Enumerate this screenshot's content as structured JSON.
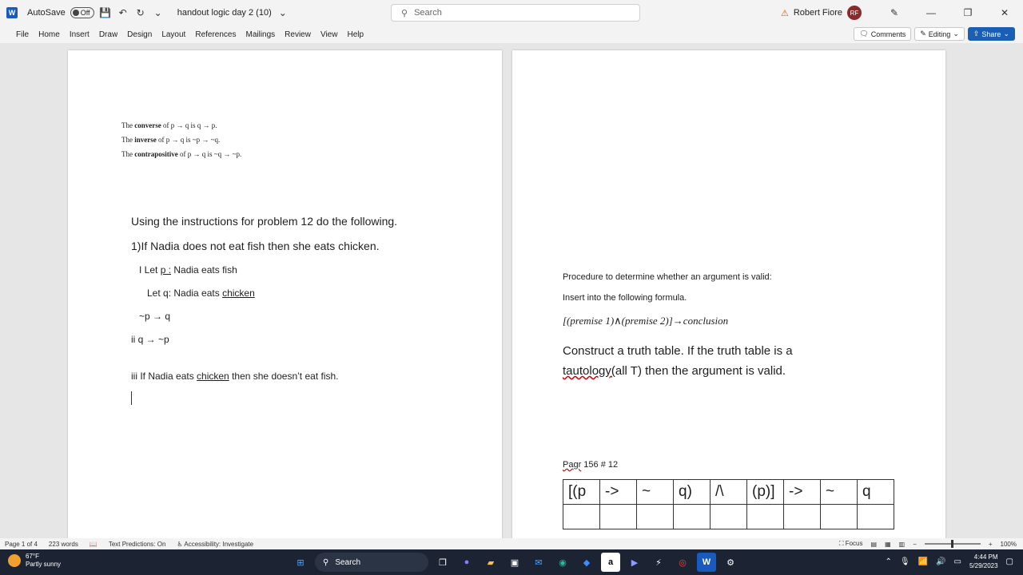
{
  "titlebar": {
    "autosave_label": "AutoSave",
    "autosave_state": "Off",
    "doc_name": "handout logic day 2 (10)",
    "search_placeholder": "Search",
    "user_name": "Robert Fiore",
    "user_initials": "RF"
  },
  "menu": {
    "items": [
      "File",
      "Home",
      "Insert",
      "Draw",
      "Design",
      "Layout",
      "References",
      "Mailings",
      "Review",
      "View",
      "Help"
    ],
    "comments": "Comments",
    "editing": "Editing",
    "share": "Share"
  },
  "page1": {
    "def1_pre": "The ",
    "def1_bold": "converse",
    "def1_post": " of p → q is q → p.",
    "def2_pre": "The ",
    "def2_bold": "inverse",
    "def2_post": " of p → q is ~p → ~q.",
    "def3_pre": "The ",
    "def3_bold": "contrapositive",
    "def3_post": " of p → q is ~q → ~p.",
    "instructions": "Using the instructions for problem 12 do the following.",
    "problem1": "1)If Nadia does not eat fish then she eats chicken.",
    "let_p_pre": "I Let ",
    "let_p_var": "p :",
    "let_p_post": "  Nadia eats fish",
    "let_q_pre": "Let q:  Nadia eats ",
    "let_q_word": "chicken",
    "expr1": "~p → q",
    "expr2": "ii    q → ~p",
    "iii_pre": "iii   If Nadia eats ",
    "iii_word": "chicken",
    "iii_post": " then she doesn’t eat fish."
  },
  "page2": {
    "procedure": "Procedure to determine whether an argument is valid:",
    "insert": "Insert into the following formula.",
    "formula": "[(premise 1)∧(premise 2)]→conclusion",
    "construct_line1": "Construct a truth table.  If the truth table is a",
    "construct_word": "tautology(",
    "construct_rest": "all T) then the argument is valid.",
    "page_ref_word": "Pagr",
    "page_ref_rest": " 156 # 12",
    "table_header": [
      "[(p",
      "->",
      "~",
      "q)",
      "/\\",
      "(p)]",
      "->",
      "~",
      "q"
    ]
  },
  "statusbar": {
    "page": "Page 1 of 4",
    "words": "223 words",
    "predictions": "Text Predictions: On",
    "accessibility": "Accessibility: Investigate",
    "focus": "Focus",
    "zoom": "100%"
  },
  "taskbar": {
    "temp": "67°F",
    "weather": "Partly sunny",
    "search": "Search",
    "time": "4:44 PM",
    "date": "5/29/2023"
  }
}
